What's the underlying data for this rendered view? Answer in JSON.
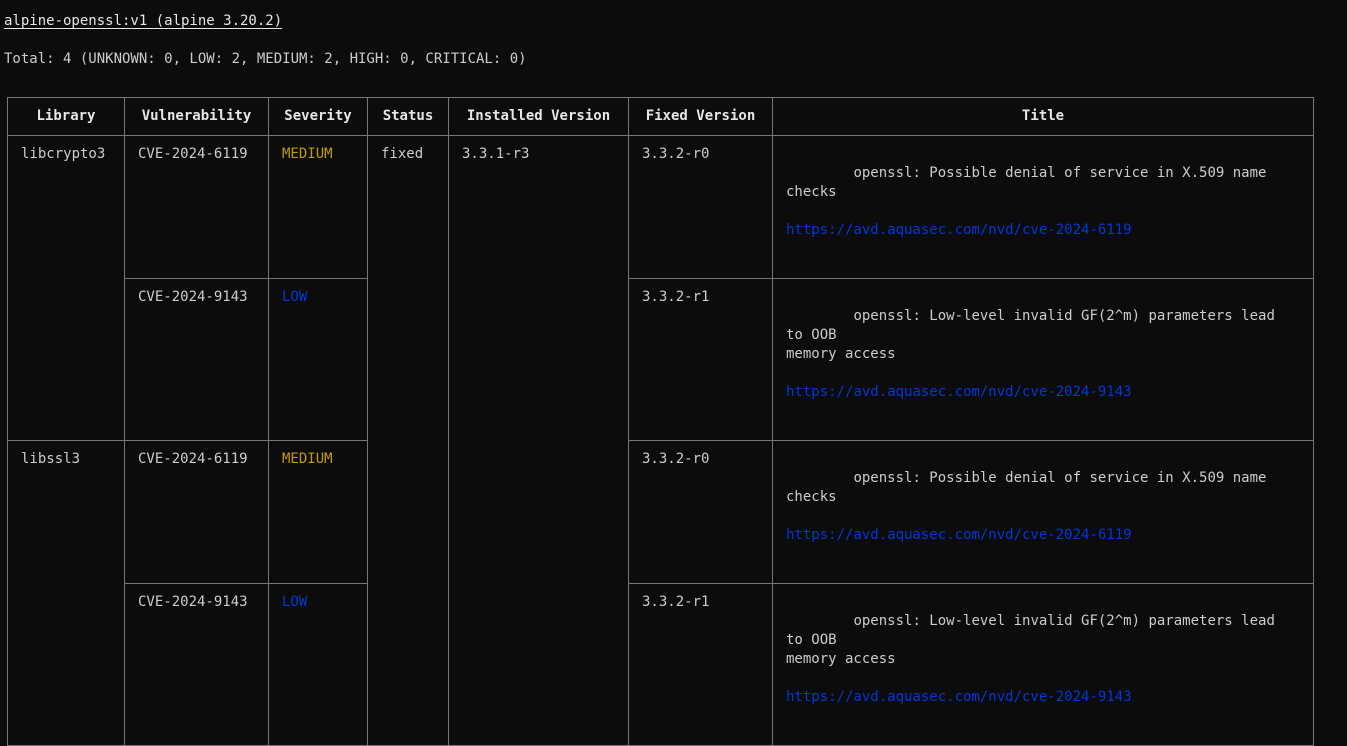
{
  "report": {
    "target": "alpine-openssl:v1 (alpine 3.20.2)",
    "total": "Total: 4 (UNKNOWN: 0, LOW: 2, MEDIUM: 2, HIGH: 0, CRITICAL: 0)"
  },
  "table": {
    "headers": {
      "library": "Library",
      "vulnerability": "Vulnerability",
      "severity": "Severity",
      "status": "Status",
      "installed": "Installed Version",
      "fixed": "Fixed Version",
      "title": "Title"
    },
    "rows": [
      {
        "library": "libcrypto3",
        "vulnerability": "CVE-2024-6119",
        "severity": "MEDIUM",
        "status": "fixed",
        "installed": "3.3.1-r3",
        "fixed": "3.3.2-r0",
        "title": "openssl: Possible denial of service in X.509 name checks",
        "url": "https://avd.aquasec.com/nvd/cve-2024-6119"
      },
      {
        "library": "",
        "vulnerability": "CVE-2024-9143",
        "severity": "LOW",
        "status": "",
        "installed": "",
        "fixed": "3.3.2-r1",
        "title": "openssl: Low-level invalid GF(2^m) parameters lead to OOB\nmemory access",
        "url": "https://avd.aquasec.com/nvd/cve-2024-9143"
      },
      {
        "library": "libssl3",
        "vulnerability": "CVE-2024-6119",
        "severity": "MEDIUM",
        "status": "",
        "installed": "",
        "fixed": "3.3.2-r0",
        "title": "openssl: Possible denial of service in X.509 name checks",
        "url": "https://avd.aquasec.com/nvd/cve-2024-6119"
      },
      {
        "library": "",
        "vulnerability": "CVE-2024-9143",
        "severity": "LOW",
        "status": "",
        "installed": "",
        "fixed": "3.3.2-r1",
        "title": "openssl: Low-level invalid GF(2^m) parameters lead to OOB\nmemory access",
        "url": "https://avd.aquasec.com/nvd/cve-2024-9143"
      }
    ]
  },
  "colors": {
    "background": "#0c0c0c",
    "text": "#cccccc",
    "medium": "#c19c00",
    "low": "#0037da",
    "link": "#0037da",
    "border": "#767676"
  }
}
